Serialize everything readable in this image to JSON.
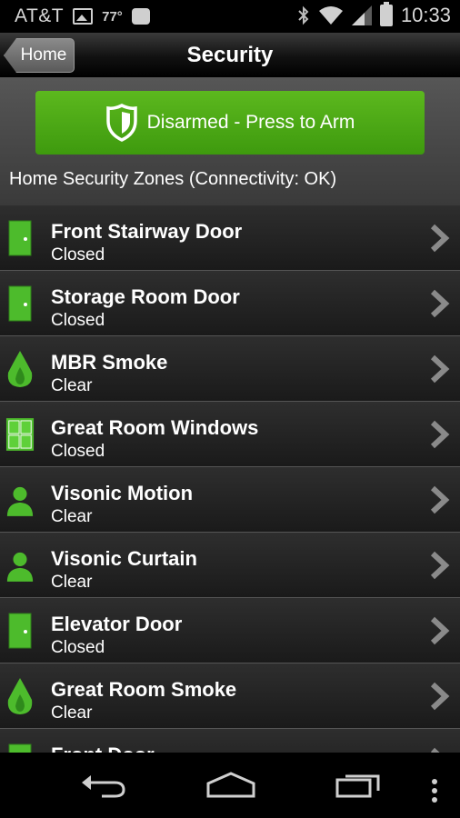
{
  "status_bar": {
    "carrier": "AT&T",
    "temperature": "77°",
    "time": "10:33"
  },
  "title_bar": {
    "back_label": "Home",
    "title": "Security"
  },
  "arm_button": {
    "label": "Disarmed - Press to Arm",
    "color": "#4fa81a"
  },
  "zones_heading": "Home Security Zones (Connectivity: OK)",
  "zones": [
    {
      "name": "Front Stairway Door",
      "status": "Closed",
      "icon": "door-icon"
    },
    {
      "name": "Storage Room Door",
      "status": "Closed",
      "icon": "door-icon"
    },
    {
      "name": "MBR Smoke",
      "status": "Clear",
      "icon": "smoke-icon"
    },
    {
      "name": "Great Room Windows",
      "status": "Closed",
      "icon": "window-icon"
    },
    {
      "name": "Visonic Motion",
      "status": "Clear",
      "icon": "motion-icon"
    },
    {
      "name": "Visonic Curtain",
      "status": "Clear",
      "icon": "motion-icon"
    },
    {
      "name": "Elevator Door",
      "status": "Closed",
      "icon": "door-icon"
    },
    {
      "name": "Great Room Smoke",
      "status": "Clear",
      "icon": "smoke-icon"
    },
    {
      "name": "Front Door",
      "status": "",
      "icon": "door-icon"
    }
  ],
  "nav": {
    "icons": [
      "back-icon",
      "home-icon",
      "recent-apps-icon",
      "menu-icon"
    ]
  },
  "colors": {
    "icon_green": "#4dbb2c",
    "accent_green": "#4fa81a"
  }
}
